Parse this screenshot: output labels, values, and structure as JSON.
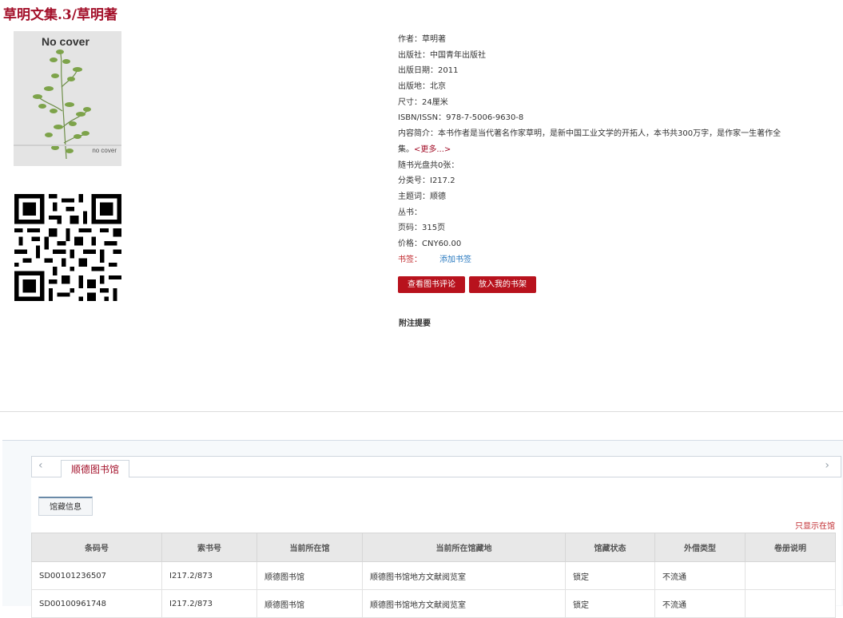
{
  "book_title": "草明文集.3/草明著",
  "cover": {
    "top_text": "No cover",
    "bottom_text": "no cover"
  },
  "info": {
    "author": "作者：草明著",
    "publisher": "出版社：中国青年出版社",
    "pub_date": "出版日期：2011",
    "pub_place": "出版地：北京",
    "size": "尺寸：24厘米",
    "isbn": "ISBN/ISSN：978-7-5006-9630-8",
    "summary": "内容简介：本书作者是当代著名作家草明，是新中国工业文学的开拓人，本书共300万字，是作家一生著作全集。",
    "more_link": "<更多...>",
    "cd_count": "随书光盘共0张：",
    "class_no": "分类号：I217.2",
    "subject": "主题词：顺德",
    "series": "丛书：",
    "pages": "页码：315页",
    "price": "价格：CNY60.00",
    "bookmark_label": "书签：",
    "bookmark_link": "添加书签"
  },
  "buttons": {
    "view_reviews": "查看图书评论",
    "add_shelf": "放入我的书架"
  },
  "notes_heading": "附注提要",
  "library_tab": "顺德图书馆",
  "holdings_tab": "馆藏信息",
  "only_show_in_library": "只显示在馆",
  "table": {
    "headers": [
      "条码号",
      "索书号",
      "当前所在馆",
      "当前所在馆藏地",
      "馆藏状态",
      "外借类型",
      "卷册说明"
    ],
    "rows": [
      [
        "SD00101236507",
        "I217.2/873",
        "顺德图书馆",
        "顺德图书馆地方文献阅览室",
        "锁定",
        "不流通",
        ""
      ],
      [
        "SD00100961748",
        "I217.2/873",
        "顺德图书馆",
        "顺德图书馆地方文献阅览室",
        "锁定",
        "不流通",
        ""
      ]
    ]
  },
  "colors": {
    "brand_red": "#a3102a",
    "button_red": "#b8121d",
    "link_blue": "#2a7ac0"
  },
  "icons": {
    "nav_prev": "chevron-left-icon",
    "nav_next": "chevron-right-icon",
    "qr": "qr-code-icon"
  }
}
